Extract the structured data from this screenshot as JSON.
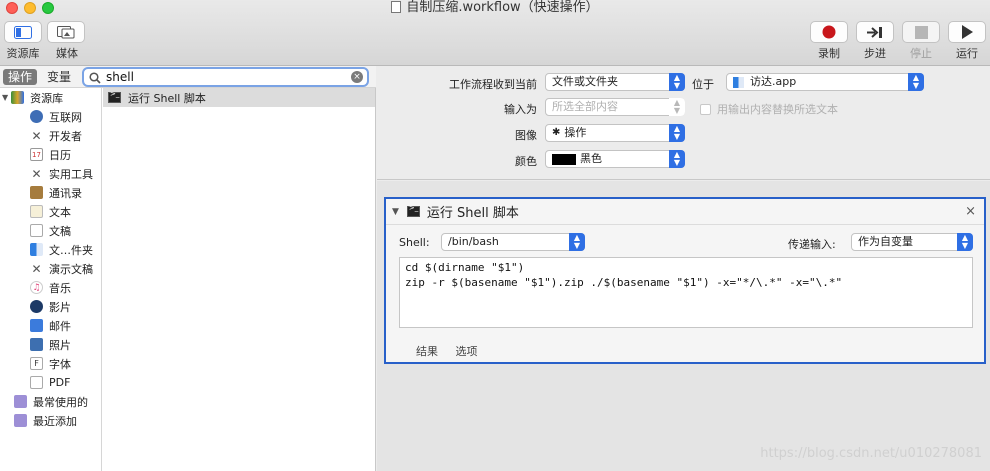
{
  "window": {
    "title": "自制压缩.workflow（快速操作）"
  },
  "toolbar": {
    "library_label": "资源库",
    "media_label": "媒体",
    "record_label": "录制",
    "step_label": "步进",
    "stop_label": "停止",
    "run_label": "运行"
  },
  "left": {
    "tab_actions": "操作",
    "tab_variables": "变量",
    "search_value": "shell",
    "library_root": "资源库",
    "library_items": [
      "互联网",
      "开发者",
      "日历",
      "实用工具",
      "通讯录",
      "文本",
      "文稿",
      "文…件夹",
      "演示文稿",
      "音乐",
      "影片",
      "邮件",
      "照片",
      "字体",
      "PDF"
    ],
    "most_used": "最常使用的",
    "recently_added": "最近添加",
    "result": "运行 Shell 脚本"
  },
  "workflow": {
    "receives_label": "工作流程收到当前",
    "receives_value": "文件或文件夹",
    "in_label": "位于",
    "in_value": "访达.app",
    "input_label": "输入为",
    "input_value": "所选全部内容",
    "replace_label": "用输出内容替换所选文本",
    "image_label": "图像",
    "image_value": "操作",
    "color_label": "颜色",
    "color_value": "黑色"
  },
  "action": {
    "title": "运行 Shell 脚本",
    "close": "×",
    "shell_label": "Shell:",
    "shell_value": "/bin/bash",
    "pass_label": "传递输入:",
    "pass_value": "作为自变量",
    "script_line1": "cd $(dirname \"$1\")",
    "script_line2": "zip -r $(basename \"$1\").zip ./$(basename \"$1\") -x=\"*/\\.*\" -x=\"\\.*\"",
    "results_tab": "结果",
    "options_tab": "选项"
  },
  "watermark": "https://blog.csdn.net/u010278081"
}
